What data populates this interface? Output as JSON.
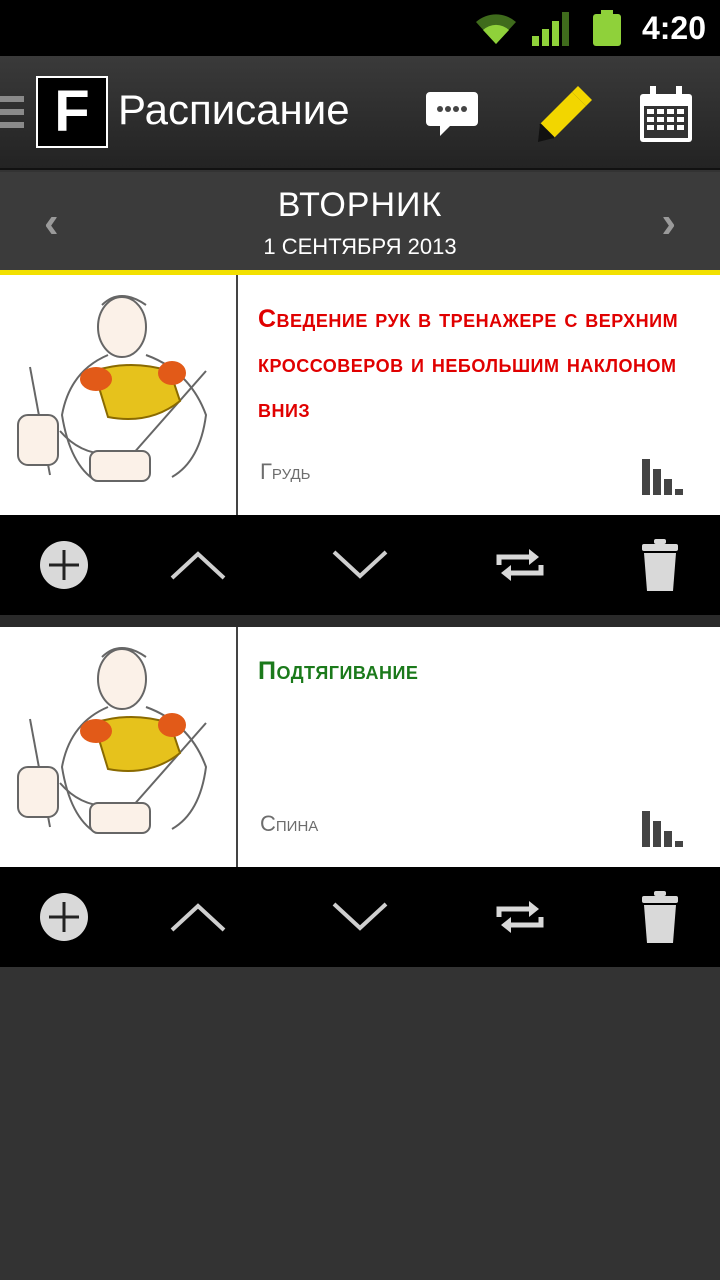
{
  "status_bar": {
    "time": "4:20"
  },
  "action_bar": {
    "logo_letter": "F",
    "title": "Расписание"
  },
  "day_header": {
    "weekday": "ВТОРНИК",
    "date": "1 СЕНТЯБРЯ 2013",
    "prev_symbol": "‹",
    "next_symbol": "›"
  },
  "colors": {
    "accent_yellow": "#f2e000",
    "title_red": "#e00000",
    "title_green": "#1b7a1b"
  },
  "exercises": [
    {
      "title": "Сведение рук в тренажере с верхним кроссоверов и небольшим наклоном вниз",
      "muscle_group": "Грудь",
      "title_color": "#e00000"
    },
    {
      "title": "Подтягивание",
      "muscle_group": "Спина",
      "title_color": "#1b7a1b"
    }
  ],
  "icons": [
    "drawer-icon",
    "comment-icon",
    "pencil-icon",
    "calendar-icon",
    "prev-arrow-icon",
    "next-arrow-icon",
    "stats-icon",
    "add-icon",
    "move-up-icon",
    "move-down-icon",
    "replace-icon",
    "trash-icon"
  ]
}
